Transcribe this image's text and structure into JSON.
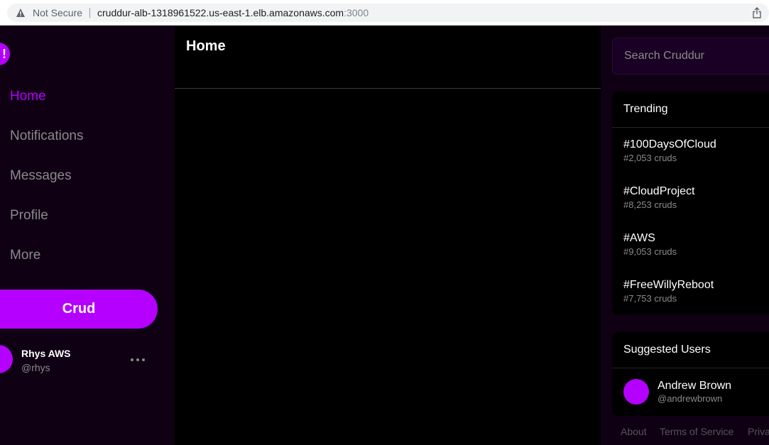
{
  "browser": {
    "security_label": "Not Secure",
    "url_host": "cruddur-alb-1318961522.us-east-1.elb.amazonaws.com",
    "url_port": ":3000"
  },
  "sidebar": {
    "logo_text": "!",
    "nav": [
      {
        "label": "Home",
        "active": true
      },
      {
        "label": "Notifications",
        "active": false
      },
      {
        "label": "Messages",
        "active": false
      },
      {
        "label": "Profile",
        "active": false
      },
      {
        "label": "More",
        "active": false
      }
    ],
    "crud_button": "Crud",
    "user": {
      "name": "Rhys AWS",
      "handle": "@rhys"
    }
  },
  "main": {
    "title": "Home"
  },
  "right": {
    "search_placeholder": "Search Cruddur",
    "trending": {
      "title": "Trending",
      "items": [
        {
          "tag": "#100DaysOfCloud",
          "count": "#2,053 cruds"
        },
        {
          "tag": "#CloudProject",
          "count": "#8,253 cruds"
        },
        {
          "tag": "#AWS",
          "count": "#9,053 cruds"
        },
        {
          "tag": "#FreeWillyReboot",
          "count": "#7,753 cruds"
        }
      ]
    },
    "suggested": {
      "title": "Suggested Users",
      "users": [
        {
          "name": "Andrew Brown",
          "handle": "@andrewbrown"
        }
      ]
    },
    "footer": [
      "About",
      "Terms of Service",
      "Priva"
    ]
  },
  "colors": {
    "accent": "#b500ff",
    "sidebar_bg": "#0f0014",
    "main_bg": "#000000"
  }
}
